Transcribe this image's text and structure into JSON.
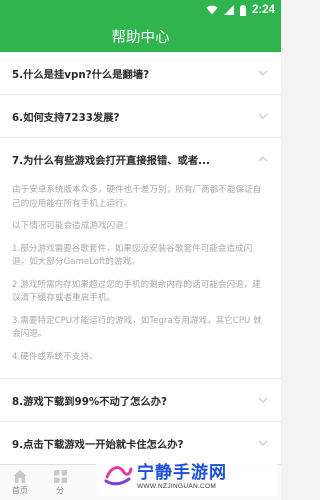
{
  "status_bar": {
    "time": "2:24"
  },
  "header": {
    "title": "帮助中心"
  },
  "faq": [
    {
      "question": "5.什么是挂vpn?什么是翻墙?",
      "expanded": false
    },
    {
      "question": "6.如何支持7233发展?",
      "expanded": false
    },
    {
      "question": "7.为什么有些游戏会打开直接报错、或者...",
      "expanded": true,
      "answer": [
        "由于安卓系统版本众多，硬件也千差万别，所有厂商都不能保证自己的应用能在所有手机上运行。",
        "以下情况可能会造成游戏闪退：",
        "1.部分游戏需要谷歌套件，如果您没安装谷歌套件可能会造成闪退，如大部分GameLoft的游戏。",
        "2.游戏所需内存如果超过您的手机的剩余内存的话可能会闪退，建议清下缓存或者重启手机。",
        "3.需要特定CPU才能运行的游戏，如Tegra专用游戏，其它CPU 就会闪退。",
        "4.硬件或系统不支持。"
      ]
    },
    {
      "question": "8.游戏下载到99%不动了怎么办?",
      "expanded": false
    },
    {
      "question": "9.点击下载游戏一开始就卡住怎么办?",
      "expanded": false
    }
  ],
  "bottom_nav": [
    {
      "label": "首页"
    },
    {
      "label": "分"
    }
  ],
  "watermark": {
    "title": "宁静手游网",
    "url": "WWW.NZJINGUAN.COM"
  },
  "colors": {
    "accent": "#2fb44e",
    "watermark": "#1d4fd8"
  }
}
